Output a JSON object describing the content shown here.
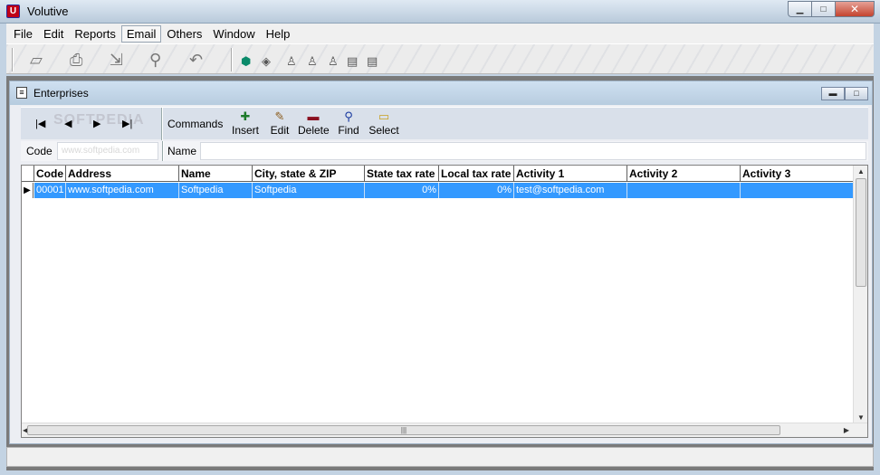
{
  "window": {
    "title": "Volutive"
  },
  "menu": [
    "File",
    "Edit",
    "Reports",
    "Email",
    "Others",
    "Window",
    "Help"
  ],
  "child": {
    "title": "Enterprises",
    "commands_label": "Commands",
    "commands": [
      {
        "label": "Insert",
        "icon": "plus-icon",
        "color": "#1d7a2a"
      },
      {
        "label": "Edit",
        "icon": "pencil-icon",
        "color": "#8a5a1a"
      },
      {
        "label": "Delete",
        "icon": "minus-icon",
        "color": "#8a1020"
      },
      {
        "label": "Find",
        "icon": "magnifier-icon",
        "color": "#1a3aa0"
      },
      {
        "label": "Select",
        "icon": "folder-icon",
        "color": "#c8a020"
      }
    ],
    "filter": {
      "code_label": "Code",
      "code_value": "www.softpedia.com",
      "name_label": "Name",
      "name_value": ""
    },
    "watermark": "SOFTPEDIA"
  },
  "grid": {
    "columns": [
      "Code",
      "Address",
      "Name",
      "City, state & ZIP",
      "State tax rate",
      "Local tax rate",
      "Activity 1",
      "Activity 2",
      "Activity 3"
    ],
    "rows": [
      [
        "00001",
        "www.softpedia.com",
        "Softpedia",
        "Softpedia",
        "0%",
        "0%",
        "test@softpedia.com",
        "",
        ""
      ]
    ],
    "selected_color": "#3399ff"
  }
}
